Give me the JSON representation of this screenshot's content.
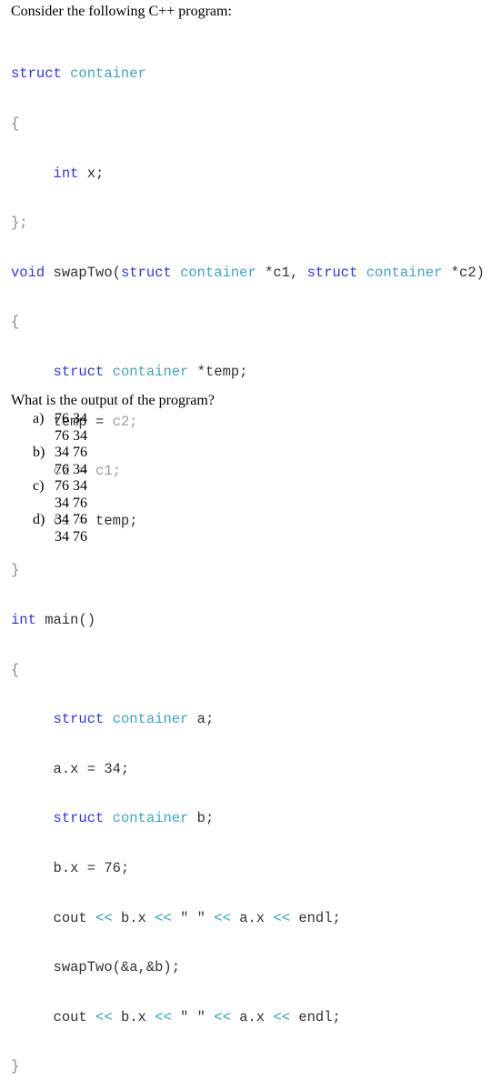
{
  "intro": "Consider the following C++ program:",
  "code": {
    "l1_kw": "struct",
    "l1_ty": "container",
    "l2": "{",
    "l3_kw": "int",
    "l3_rest": " x;",
    "l4": "};",
    "l5_kw1": "void",
    "l5_name": " swapTwo(",
    "l5_kw2": "struct",
    "l5_ty1": "container",
    "l5_p1": " *c1, ",
    "l5_kw3": "struct",
    "l5_ty2": "container",
    "l5_p2": " *c2)",
    "l6": "{",
    "l7_kw": "struct",
    "l7_ty": "container",
    "l7_rest": " *temp;",
    "l8_a": "temp = ",
    "l8_b": "c2;",
    "l9": "c2 = c1;",
    "l10_a": "c1 = ",
    "l10_b": "temp;",
    "l11": "}",
    "l12_kw": "int",
    "l12_rest": " main()",
    "l13": "{",
    "l14_kw": "struct",
    "l14_ty": "container",
    "l14_rest": " a;",
    "l15": "a.x = 34;",
    "l16_kw": "struct",
    "l16_ty": "container",
    "l16_rest": " b;",
    "l17": "b.x = 76;",
    "cout1": {
      "a": "cout ",
      "op1": "<<",
      "b": " b.x ",
      "op2": "<<",
      "c": " \" \" ",
      "op3": "<<",
      "d": " a.x ",
      "op4": "<<",
      "e": " endl;"
    },
    "l19": "swapTwo(&a,&b);",
    "cout2": {
      "a": "cout ",
      "op1": "<<",
      "b": " b.x ",
      "op2": "<<",
      "c": " \" \" ",
      "op3": "<<",
      "d": " a.x ",
      "op4": "<<",
      "e": " endl;"
    },
    "l21": "}"
  },
  "question": "What is the output of the program?",
  "options": [
    {
      "letter": "a)",
      "line1": "76 34",
      "line2": "76 34"
    },
    {
      "letter": "b)",
      "line1": "34 76",
      "line2": "76 34"
    },
    {
      "letter": "c)",
      "line1": "76 34",
      "line2": "34 76"
    },
    {
      "letter": "d)",
      "line1": "34 76",
      "line2": "34 76"
    }
  ]
}
